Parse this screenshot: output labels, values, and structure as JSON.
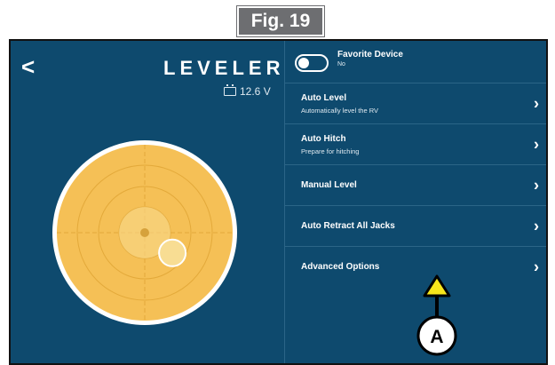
{
  "figure": {
    "label": "Fig. 19"
  },
  "header": {
    "back_icon": "chevron-left-icon",
    "back_glyph": "<",
    "title": "LEVELER",
    "battery": "12.6 V"
  },
  "favorite": {
    "title": "Favorite Device",
    "value": "No",
    "toggle_on": false
  },
  "menu": {
    "chevron_glyph": "›",
    "items": [
      {
        "label": "Auto Level",
        "sub": "Automatically level the RV"
      },
      {
        "label": "Auto Hitch",
        "sub": "Prepare for hitching"
      },
      {
        "label": "Manual Level",
        "sub": ""
      },
      {
        "label": "Auto Retract All Jacks",
        "sub": ""
      },
      {
        "label": "Advanced Options",
        "sub": ""
      }
    ]
  },
  "level_indicator": {
    "bubble_offset_x": 0.68,
    "bubble_offset_y": 0.62
  },
  "callout": {
    "label": "A"
  },
  "colors": {
    "screen_bg": "#0e4a6e",
    "level_fill": "#f5c056",
    "callout_arrow": "#f7e61b"
  }
}
